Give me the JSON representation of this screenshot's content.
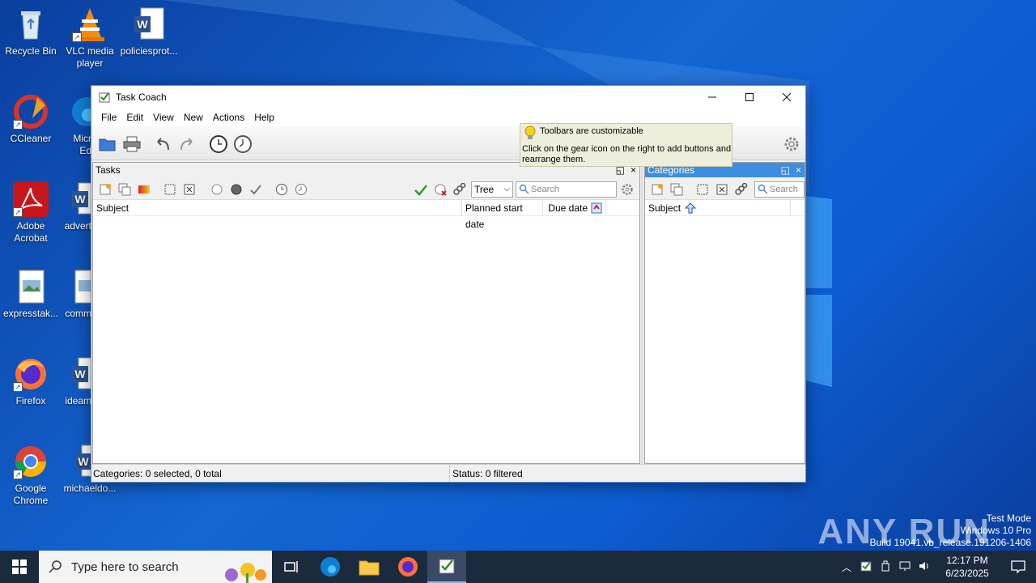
{
  "desktop": {
    "icons": [
      {
        "label": "Recycle Bin"
      },
      {
        "label": "VLC media player"
      },
      {
        "label": "policiesprot..."
      },
      {
        "label": "CCleaner"
      },
      {
        "label": "Micr Ed"
      },
      {
        "label": "Adobe Acrobat"
      },
      {
        "label": "advert"
      },
      {
        "label": "expresstak..."
      },
      {
        "label": "comm"
      },
      {
        "label": "Firefox"
      },
      {
        "label": "ideam"
      },
      {
        "label": "Google Chrome"
      },
      {
        "label": "michaeldo..."
      }
    ]
  },
  "window": {
    "title": "Task Coach",
    "menu": [
      "File",
      "Edit",
      "View",
      "New",
      "Actions",
      "Help"
    ],
    "tooltip": {
      "title": "Toolbars are customizable",
      "body": "Click on the gear icon on the right to add buttons and rearrange them."
    },
    "tasks_pane": {
      "title": "Tasks",
      "view_select": "Tree",
      "search_placeholder": "Search",
      "columns": [
        "Subject",
        "Planned start date",
        "Due date"
      ]
    },
    "categories_pane": {
      "title": "Categories",
      "search_placeholder": "Search",
      "columns": [
        "Subject"
      ]
    },
    "status": {
      "left": "Categories: 0 selected, 0 total",
      "right": "Status: 0 filtered"
    }
  },
  "taskbar": {
    "search_placeholder": "Type here to search",
    "time": "12:17 PM",
    "date": "6/23/2025"
  },
  "watermark": {
    "brand": "ANY RUN",
    "line1": "Test Mode",
    "line2": "Windows 10 Pro",
    "line3": "Build 19041.vb_release.191206-1406"
  },
  "colors": {
    "desktop": "#0d5bd0",
    "categories_header": "#3d8ee0",
    "tooltip_bg": "#eeeedc",
    "taskbar": "#1c2a3d"
  }
}
